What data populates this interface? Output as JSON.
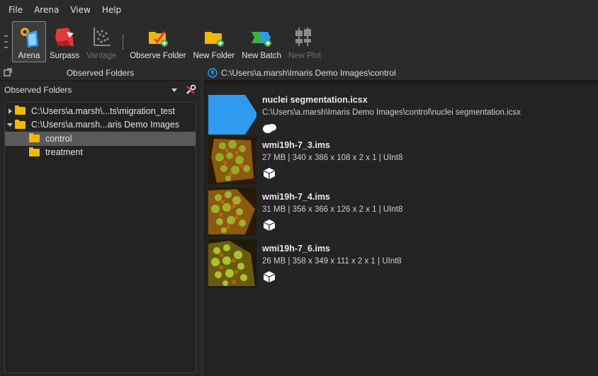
{
  "menu": [
    "File",
    "Arena",
    "View",
    "Help"
  ],
  "toolbar": {
    "arena": "Arena",
    "surpass": "Surpass",
    "vantage": "Vantage",
    "observe_folder": "Observe Folder",
    "new_folder": "New Folder",
    "new_batch": "New Batch",
    "new_plot": "New Plot"
  },
  "left_panel": {
    "title": "Observed Folders",
    "combo_value": "Observed Folders",
    "tree": [
      {
        "label": "C:\\Users\\a.marsh\\...ts\\migration_test",
        "expanded": false
      },
      {
        "label": "C:\\Users\\a.marsh...aris Demo Images",
        "expanded": true
      },
      {
        "label": "control",
        "selected": true
      },
      {
        "label": "treatment",
        "selected": false
      }
    ]
  },
  "right_panel": {
    "path": "C:\\Users\\a.marsh\\Imaris Demo Images\\control",
    "items": [
      {
        "name": "nuclei segmentation.icsx",
        "meta": "C:\\Users\\a.marsh\\Imaris Demo Images\\control\\nuclei segmentation.icsx",
        "icon": "cell-blob-icon"
      },
      {
        "name": "wmi19h-7_3.ims",
        "meta": "27 MB | 340 x 386 x 108 x 2 x 1 | UInt8",
        "icon": "cube-icon"
      },
      {
        "name": "wmi19h-7_4.ims",
        "meta": "31 MB | 356 x 366 x 126 x 2 x 1 | UInt8",
        "icon": "cube-icon"
      },
      {
        "name": "wmi19h-7_6.ims",
        "meta": "26 MB | 358 x 349 x 111 x 2 x 1 | UInt8",
        "icon": "cube-icon"
      }
    ]
  },
  "colors": {
    "background": "#1e1e1e",
    "folder": "#f2b800",
    "accent_blue": "#2f9bf0",
    "selection": "#5a5a5a"
  }
}
